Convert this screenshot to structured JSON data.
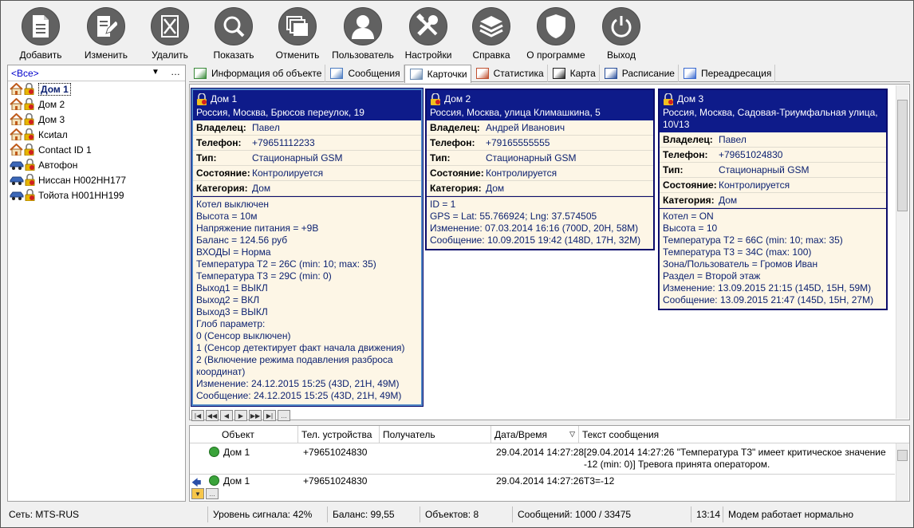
{
  "toolbar": [
    {
      "label": "Добавить",
      "icon": "add-document-icon"
    },
    {
      "label": "Изменить",
      "icon": "edit-document-icon"
    },
    {
      "label": "Удалить",
      "icon": "delete-icon"
    },
    {
      "label": "Показать",
      "icon": "search-icon"
    },
    {
      "label": "Отменить",
      "icon": "cancel-icon"
    },
    {
      "label": "Пользователь",
      "icon": "user-icon"
    },
    {
      "label": "Настройки",
      "icon": "settings-icon"
    },
    {
      "label": "Справка",
      "icon": "help-layers-icon"
    },
    {
      "label": "О программе",
      "icon": "shield-icon"
    },
    {
      "label": "Выход",
      "icon": "power-icon"
    }
  ],
  "tree": {
    "filter": "<Все>",
    "items": [
      {
        "label": "Дом 1",
        "type": "house",
        "selected": true
      },
      {
        "label": "Дом 2",
        "type": "house"
      },
      {
        "label": "Дом 3",
        "type": "house"
      },
      {
        "label": "Ксиtал",
        "type": "house"
      },
      {
        "label": "Contact ID 1",
        "type": "house"
      },
      {
        "label": "Автофон",
        "type": "car"
      },
      {
        "label": "Ниссан Н002НН177",
        "type": "car"
      },
      {
        "label": "Тойота Н001НН199",
        "type": "car"
      }
    ]
  },
  "tabs": [
    {
      "label": "Информация об объекте"
    },
    {
      "label": "Сообщения"
    },
    {
      "label": "Карточки",
      "active": true
    },
    {
      "label": "Статистика"
    },
    {
      "label": "Карта"
    },
    {
      "label": "Расписание"
    },
    {
      "label": "Переадресация"
    }
  ],
  "field_labels": {
    "owner": "Владелец:",
    "phone": "Телефон:",
    "type": "Тип:",
    "state": "Состояние:",
    "category": "Категория:"
  },
  "cards": [
    {
      "name": "Дом 1",
      "address": "Россия, Москва, Брюсов переулок, 19",
      "owner": "Павел",
      "phone": "+79651112233",
      "type": "Стационарный GSM",
      "state": "Контролируется",
      "category": "Дом",
      "lines": [
        "Котел выключен",
        "Высота = 10м",
        "Напряжение питания = +9В",
        "Баланс = 124.56 руб",
        "ВХОДЫ = Норма",
        "Температура Т2 = 26С (min: 10; max: 35)",
        "Температура Т3 = 29С (min: 0)",
        "Выход1 = ВЫКЛ",
        "Выход2 = ВКЛ",
        "Выход3 = ВЫКЛ",
        "Глоб параметр:",
        "0 (Сенсор выключен)",
        "1 (Сенсор детектирует факт начала движения)",
        "2 (Включение режима подавления разброса координат)",
        "Изменение: 24.12.2015 15:25 (43D, 21H, 49M)",
        "Сообщение: 24.12.2015 15:25 (43D, 21H, 49M)"
      ]
    },
    {
      "name": "Дом 2",
      "address": "Россия, Москва, улица Климашкина, 5",
      "owner": "Андрей Иванович",
      "phone": "+79165555555",
      "type": "Стационарный GSM",
      "state": "Контролируется",
      "category": "Дом",
      "lines": [
        "ID = 1",
        "GPS = Lat: 55.766924; Lng: 37.574505",
        "Изменение: 07.03.2014 16:16 (700D, 20H, 58M)",
        "Сообщение: 10.09.2015 19:42 (148D, 17H, 32M)"
      ]
    },
    {
      "name": "Дом 3",
      "address": "Россия, Москва, Садовая-Триумфальная улица, 10\\/13",
      "owner": "Павел",
      "phone": "+79651024830",
      "type": "Стационарный GSM",
      "state": "Контролируется",
      "category": "Дом",
      "lines": [
        "Котел = ON",
        "Высота = 10",
        "Температура Т2 = 66С (min: 10; max: 35)",
        "Температура Т3 = 34С (max: 100)",
        "Зона/Пользователь = Громов Иван",
        "Раздел = Второй этаж",
        "Изменение: 13.09.2015 21:15 (145D, 15H, 59M)",
        "Сообщение: 13.09.2015 21:47 (145D, 15H, 27M)"
      ]
    }
  ],
  "messages": {
    "columns": [
      "Объект",
      "Тел. устройства",
      "Получатель",
      "Дата/Время",
      "Текст сообщения"
    ],
    "rows": [
      {
        "object": "Дом 1",
        "phone": "+79651024830",
        "recipient": "",
        "datetime": "29.04.2014 14:27:28",
        "text1": "[29.04.2014 14:27:26 \"Температура Т3\" имеет критическое значение",
        "text2": "-12 (min: 0)] Тревога принята оператором."
      },
      {
        "object": "Дом 1",
        "phone": "+79651024830",
        "recipient": "",
        "datetime": "29.04.2014 14:27:26",
        "text1": "Т3=-12",
        "text2": ""
      }
    ]
  },
  "status": {
    "network": "Сеть: MTS-RUS",
    "signal": "Уровень сигнала: 42%",
    "balance": "Баланс: 99,55",
    "objects": "Объектов: 8",
    "messages": "Сообщений: 1000 / 33475",
    "time": "13:14",
    "modem": "Модем работает нормально"
  }
}
